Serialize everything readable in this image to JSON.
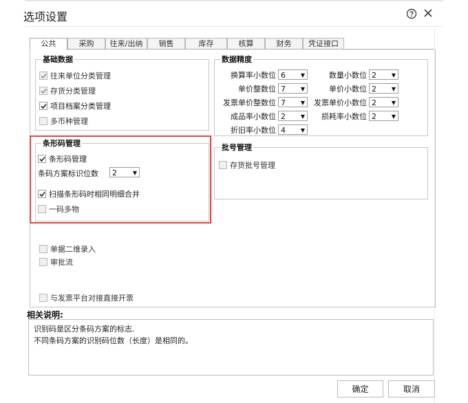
{
  "dialog": {
    "title": "选项设置",
    "help_icon": "question-circle-icon",
    "close_icon": "close-icon"
  },
  "tabs": [
    {
      "label": "公共",
      "active": true
    },
    {
      "label": "采购",
      "active": false
    },
    {
      "label": "往来/出纳",
      "active": false
    },
    {
      "label": "销售",
      "active": false
    },
    {
      "label": "库存",
      "active": false
    },
    {
      "label": "核算",
      "active": false
    },
    {
      "label": "财务",
      "active": false
    },
    {
      "label": "凭证接口",
      "active": false
    }
  ],
  "basic": {
    "legend": "基础数据",
    "items": [
      {
        "label": "往来单位分类管理",
        "checked": true,
        "disabled": true
      },
      {
        "label": "存货分类管理",
        "checked": true,
        "disabled": true
      },
      {
        "label": "项目档案分类管理",
        "checked": true,
        "disabled": false
      },
      {
        "label": "多币种管理",
        "checked": false,
        "disabled": true
      }
    ]
  },
  "precision": {
    "legend": "数据精度",
    "left": [
      {
        "label": "换算率小数位",
        "value": "6"
      },
      {
        "label": "单价整数位",
        "value": "7"
      },
      {
        "label": "发票单价整数位",
        "value": "7"
      },
      {
        "label": "成品率小数位",
        "value": "2"
      },
      {
        "label": "折旧率小数位",
        "value": "4"
      }
    ],
    "right": [
      {
        "label": "数量小数位",
        "value": "2"
      },
      {
        "label": "单价小数位",
        "value": "2"
      },
      {
        "label": "发票单价小数位",
        "value": "2"
      },
      {
        "label": "损耗率小数位",
        "value": "2"
      }
    ]
  },
  "barcode": {
    "legend": "条形码管理",
    "manage": {
      "label": "条形码管理",
      "checked": true
    },
    "digits_label": "条码方案标识位数",
    "digits_value": "2",
    "merge": {
      "label": "扫描条形码时相同明细合并",
      "checked": true
    },
    "multi": {
      "label": "一码多物",
      "checked": false
    }
  },
  "batch": {
    "legend": "批号管理",
    "item": {
      "label": "存货批号管理",
      "checked": false
    }
  },
  "misc": [
    {
      "label": "单据二维录入",
      "checked": false
    },
    {
      "label": "审批流",
      "checked": false
    },
    {
      "label": "与发票平台对接直接开票",
      "checked": false
    }
  ],
  "description": {
    "title": "相关说明:",
    "lines": [
      "识别码是区分条码方案的标志.",
      "不同条码方案的识别码位数（长度）是相同的。"
    ]
  },
  "buttons": {
    "ok": "确定",
    "cancel": "取消"
  }
}
